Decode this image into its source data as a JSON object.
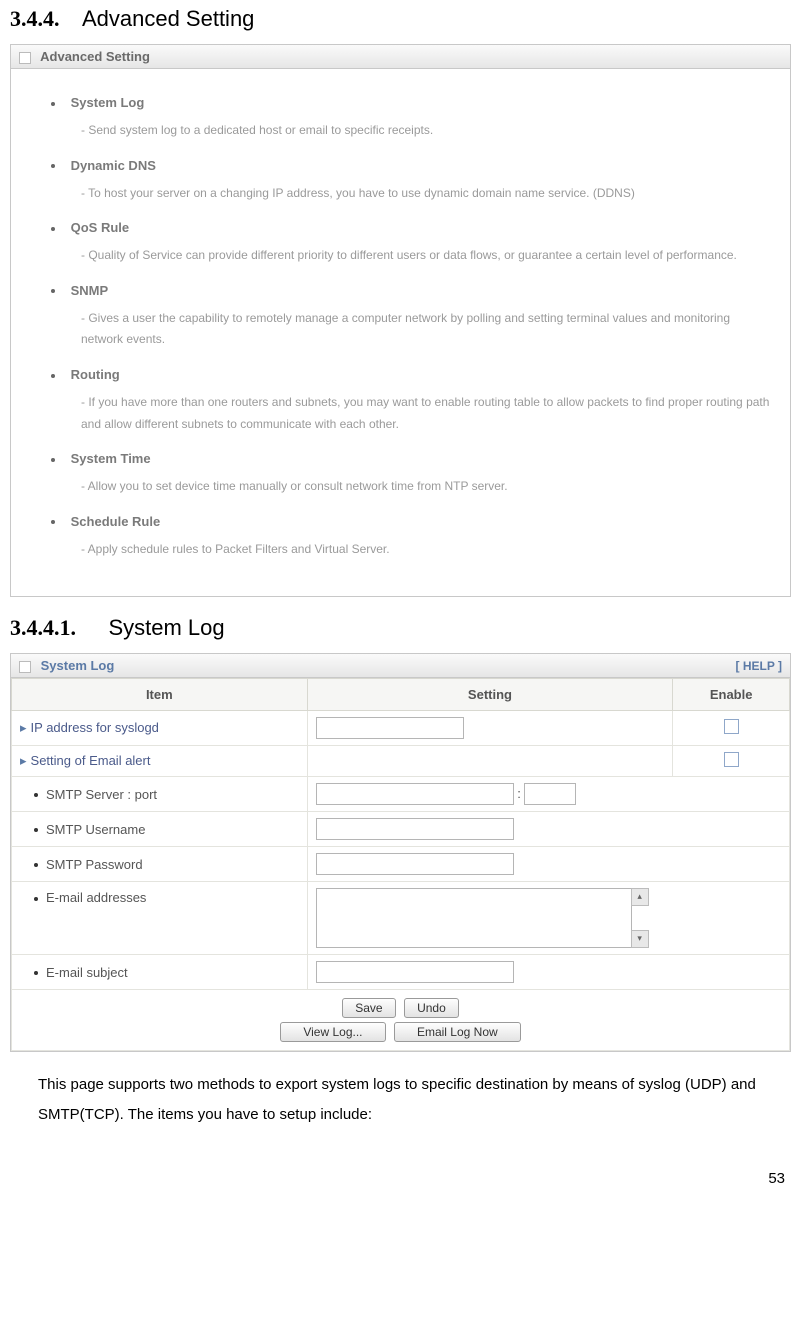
{
  "heading1": {
    "num": "3.4.4.",
    "title": "Advanced Setting"
  },
  "advPanel": {
    "title": "Advanced Setting",
    "items": [
      {
        "title": "System Log",
        "desc": "- Send system log to a dedicated host or email to specific receipts."
      },
      {
        "title": "Dynamic DNS",
        "desc": "- To host your server on a changing IP address, you have to use dynamic domain name service. (DDNS)"
      },
      {
        "title": "QoS Rule",
        "desc": "- Quality of Service can provide different priority to different users or data flows, or guarantee a certain level of performance."
      },
      {
        "title": "SNMP",
        "desc": "- Gives a user the capability to remotely manage a computer network by polling and setting terminal values and monitoring network events."
      },
      {
        "title": "Routing",
        "desc": "- If you have more than one routers and subnets, you may want to enable routing table to allow packets to find proper routing path and allow different subnets to communicate with each other."
      },
      {
        "title": "System Time",
        "desc": "- Allow you to set device time manually or consult network time from NTP server."
      },
      {
        "title": "Schedule Rule",
        "desc": "- Apply schedule rules to Packet Filters and Virtual Server."
      }
    ]
  },
  "heading2": {
    "num": "3.4.4.1.",
    "title": "System Log"
  },
  "slPanel": {
    "title": "System Log",
    "help": "[ HELP ]",
    "headers": {
      "item": "Item",
      "setting": "Setting",
      "enable": "Enable"
    },
    "rows": {
      "ip": "IP address for syslogd",
      "email": "Setting of Email alert",
      "smtpServer": "SMTP Server : port",
      "smtpUser": "SMTP Username",
      "smtpPass": "SMTP Password",
      "emailAddr": "E-mail addresses",
      "emailSubj": "E-mail subject"
    },
    "buttons": {
      "save": "Save",
      "undo": "Undo",
      "viewlog": "View Log...",
      "emaillog": "Email Log Now"
    }
  },
  "bodyText": "This page supports two methods to export system logs to specific destination by means of syslog (UDP) and SMTP(TCP). The items you have to setup include:",
  "pageNum": "53"
}
